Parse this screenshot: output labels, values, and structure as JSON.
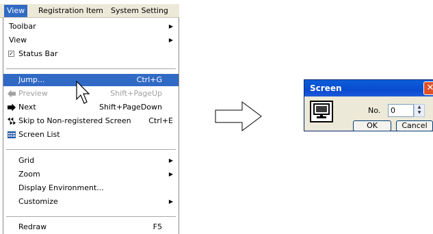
{
  "menubar": {
    "view": "View",
    "registration_item": "Registration Item",
    "system_setting": "System Setting"
  },
  "menu": {
    "toolbar": "Toolbar",
    "view": "View",
    "status_bar": "Status Bar",
    "jump": "Jump...",
    "jump_shortcut": "Ctrl+G",
    "preview": "Preview",
    "preview_shortcut": "Shift+PageUp",
    "next": "Next",
    "next_shortcut": "Shift+PageDown",
    "skip": "Skip to Non-registered Screen",
    "skip_shortcut": "Ctrl+E",
    "screen_list": "Screen List",
    "grid": "Grid",
    "zoom": "Zoom",
    "display_environment": "Display Environment...",
    "customize": "Customize",
    "redraw": "Redraw",
    "redraw_shortcut": "F5"
  },
  "dialog": {
    "title": "Screen",
    "no_label": "No.",
    "no_value": "0",
    "ok": "OK",
    "cancel": "Cancel"
  },
  "colors": {
    "highlight": "#316ac5",
    "titlebar": "#0a4bd0",
    "close": "#e0502a"
  }
}
